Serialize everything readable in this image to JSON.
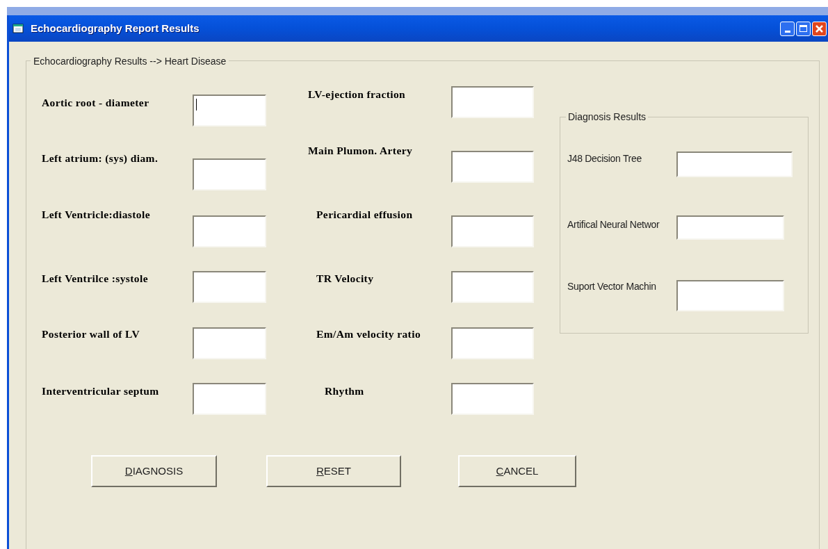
{
  "window": {
    "title": "Echocardiography Report Results"
  },
  "input_group": {
    "title": "Echocardiography Results --> Heart Disease",
    "left_fields": [
      {
        "label": "Aortic root - diameter",
        "focused": true
      },
      {
        "label": "Left atrium: (sys) diam.",
        "focused": false
      },
      {
        "label": "Left Ventricle:diastole",
        "focused": false
      },
      {
        "label": "Left Ventrilce :systole",
        "focused": false
      },
      {
        "label": "Posterior wall of LV",
        "focused": false
      },
      {
        "label": "Interventricular septum",
        "focused": false
      }
    ],
    "middle_fields": [
      {
        "label": "LV-ejection fraction",
        "focused": false
      },
      {
        "label": "Main Plumon. Artery",
        "focused": false
      },
      {
        "label": "Pericardial effusion",
        "focused": false
      },
      {
        "label": "TR  Velocity",
        "focused": false
      },
      {
        "label": "Em/Am velocity ratio",
        "focused": false
      },
      {
        "label": "Rhythm",
        "focused": false
      }
    ]
  },
  "diagnosis_results": {
    "title": "Diagnosis Results",
    "fields": [
      {
        "label": "J48 Decision Tree"
      },
      {
        "label": "Artifical Neural Networ"
      },
      {
        "label": "Suport Vector Machin"
      }
    ]
  },
  "buttons": [
    {
      "label": "DIAGNOSIS",
      "mnemonic_underlined": true
    },
    {
      "label": "RESET",
      "mnemonic_underlined": true
    },
    {
      "label": "CANCEL",
      "mnemonic_underlined": true
    }
  ]
}
